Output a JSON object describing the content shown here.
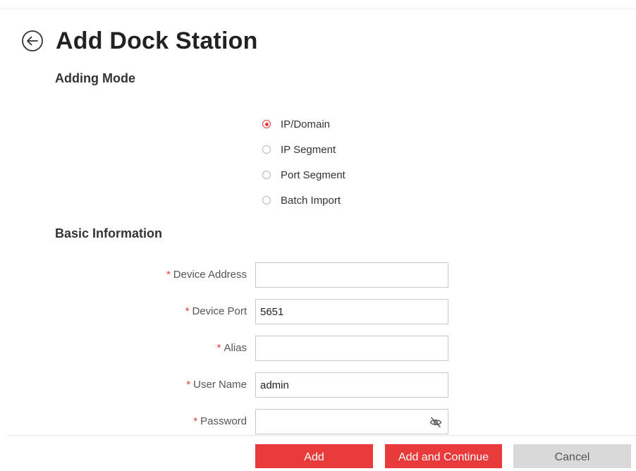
{
  "header": {
    "title": "Add Dock Station",
    "back_icon": "arrow-left-circle-icon"
  },
  "adding_mode": {
    "title": "Adding Mode",
    "options": [
      {
        "label": "IP/Domain",
        "selected": true
      },
      {
        "label": "IP Segment",
        "selected": false
      },
      {
        "label": "Port Segment",
        "selected": false
      },
      {
        "label": "Batch Import",
        "selected": false
      }
    ]
  },
  "basic_info": {
    "title": "Basic Information",
    "required_mark": "*",
    "fields": {
      "device_address": {
        "label": "Device Address",
        "value": ""
      },
      "device_port": {
        "label": "Device Port",
        "value": "5651"
      },
      "alias": {
        "label": "Alias",
        "value": ""
      },
      "user_name": {
        "label": "User Name",
        "value": "admin"
      },
      "password": {
        "label": "Password",
        "value": "",
        "toggle_icon": "eye-hidden-icon"
      }
    }
  },
  "footer": {
    "add_label": "Add",
    "add_continue_label": "Add and Continue",
    "cancel_label": "Cancel"
  },
  "colors": {
    "accent": "#e83a3a",
    "cancel_bg": "#d9d9d9",
    "border": "#c9c9c9"
  }
}
